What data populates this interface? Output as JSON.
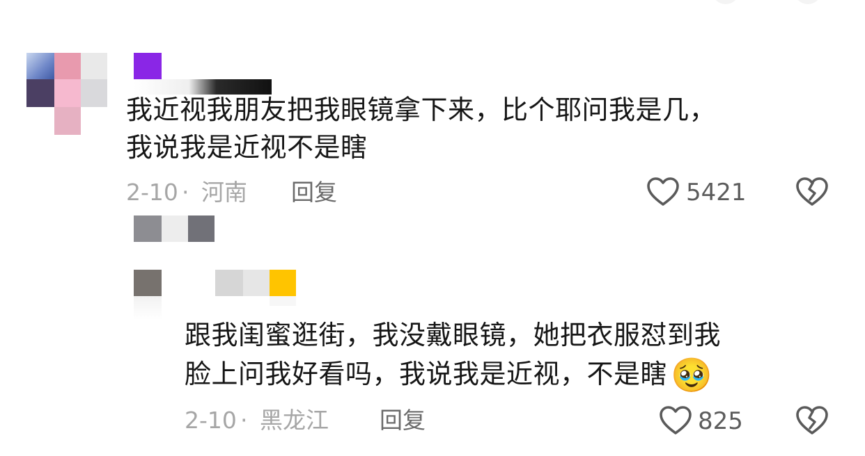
{
  "comments": [
    {
      "text_line1": "我近视我朋友把我眼镜拿下来，比个耶问我是几，",
      "text_line2": "我说我是近视不是瞎",
      "date": "2-10",
      "location": "河南",
      "reply_label": "回复",
      "like_count": "5421"
    },
    {
      "text_line1": "跟我闺蜜逛街，我没戴眼镜，她把衣服怼到我",
      "text_line2": "脸上问我好看吗，我说我是近视，不是瞎",
      "emoji": "🥹",
      "date": "2-10",
      "location": "黑龙江",
      "reply_label": "回复",
      "like_count": "825"
    }
  ],
  "separator": "·",
  "icons": {
    "like": "heart-outline-icon",
    "dislike": "broken-heart-icon",
    "emoji": "pleading-face-emoji"
  },
  "colors": {
    "text": "#161616",
    "meta": "#a6a6a6",
    "reply": "#6a6a6a",
    "count": "#5c5c5c",
    "icon": "#5a5a5a"
  }
}
